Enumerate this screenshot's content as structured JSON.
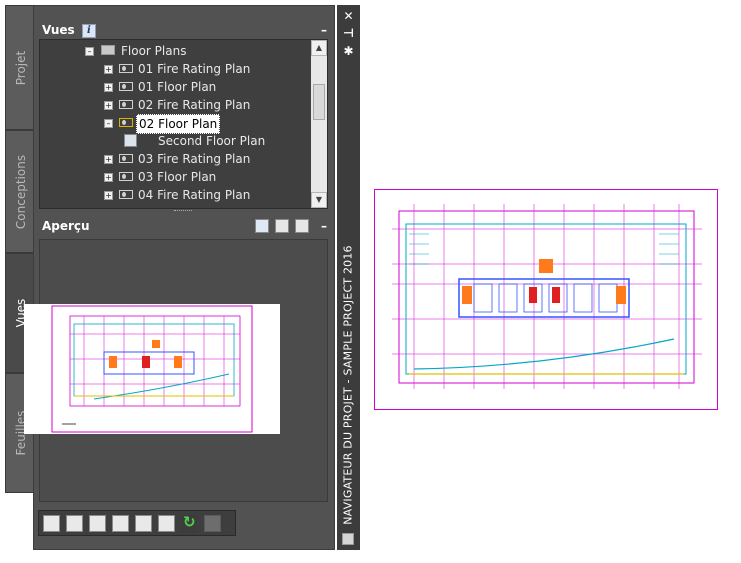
{
  "sidebar": {
    "tabs": [
      {
        "label": "Projet"
      },
      {
        "label": "Conceptions"
      },
      {
        "label": "Vues"
      },
      {
        "label": "Feuilles"
      }
    ]
  },
  "views_section": {
    "title": "Vues",
    "collapse_label": "–",
    "info_label": "i"
  },
  "tree": {
    "items": [
      {
        "label": "Floor Plans"
      },
      {
        "label": "01 Fire Rating Plan"
      },
      {
        "label": "01 Floor Plan"
      },
      {
        "label": "02 Fire Rating Plan"
      },
      {
        "label": "02 Floor Plan"
      },
      {
        "label": "Second Floor Plan"
      },
      {
        "label": "03 Fire Rating Plan"
      },
      {
        "label": "03 Floor Plan"
      },
      {
        "label": "04 Fire Rating Plan"
      }
    ],
    "selected": "02 Floor Plan"
  },
  "preview_section": {
    "title": "Aperçu",
    "collapse_label": "–"
  },
  "palette": {
    "title": "NAVIGATEUR DU PROJET - SAMPLE PROJECT 2016",
    "close_label": "✕",
    "pin_label": "⊣",
    "settings_label": "✱"
  },
  "icons": {
    "expand": "+",
    "collapse": "–",
    "scroll_up": "▲",
    "scroll_down": "▼"
  },
  "colors": {
    "panel_bg": "#525252",
    "tree_bg": "#3f3f3f",
    "plan_magenta": "#d100d1",
    "plan_cyan": "#00a8c8",
    "plan_blue": "#3355ff",
    "plan_red": "#e02020",
    "plan_orange": "#ff7a1a"
  }
}
